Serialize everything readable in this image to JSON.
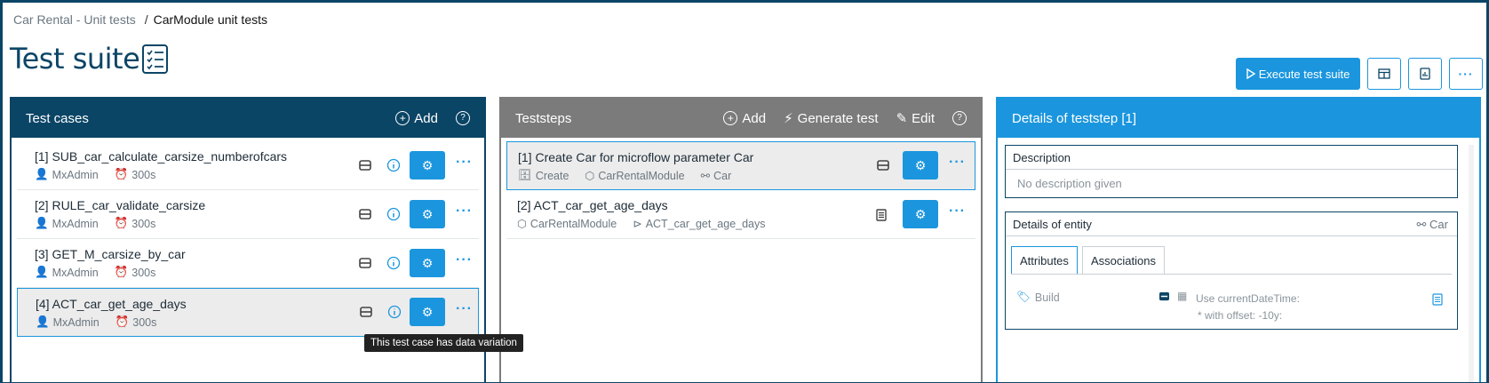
{
  "breadcrumb": {
    "parent": "Car Rental - Unit tests",
    "separator": "/",
    "current": "CarModule unit tests"
  },
  "page": {
    "title": "Test suite"
  },
  "toolbar": {
    "execute_label": "Execute test suite"
  },
  "test_cases": {
    "title": "Test cases",
    "add_label": "Add",
    "items": [
      {
        "title": "[1] SUB_car_calculate_carsize_numberofcars",
        "user": "MxAdmin",
        "timeout": "300s"
      },
      {
        "title": "[2] RULE_car_validate_carsize",
        "user": "MxAdmin",
        "timeout": "300s"
      },
      {
        "title": "[3] GET_M_carsize_by_car",
        "user": "MxAdmin",
        "timeout": "300s"
      },
      {
        "title": "[4] ACT_car_get_age_days",
        "user": "MxAdmin",
        "timeout": "300s"
      }
    ],
    "tooltip": "This test case has data variation"
  },
  "teststeps": {
    "title": "Teststeps",
    "add_label": "Add",
    "generate_label": "Generate test",
    "edit_label": "Edit",
    "items": [
      {
        "title": "[1] Create Car for microflow parameter Car",
        "action": "Create",
        "module": "CarRentalModule",
        "entity": "Car"
      },
      {
        "title": "[2] ACT_car_get_age_days",
        "module": "CarRentalModule",
        "microflow": "ACT_car_get_age_days"
      }
    ]
  },
  "details": {
    "title": "Details of teststep [1]",
    "description_label": "Description",
    "description_value": "No description given",
    "entity_label": "Details of entity",
    "entity_name": "Car",
    "tabs": [
      "Attributes",
      "Associations"
    ],
    "attribute": {
      "name": "Build",
      "value_line1": "Use currentDateTime:",
      "value_line2": "* with offset: -10y:"
    }
  },
  "colors": {
    "navy": "#0b4566",
    "blue": "#1b96de",
    "gray_header": "#7b7b7b"
  }
}
